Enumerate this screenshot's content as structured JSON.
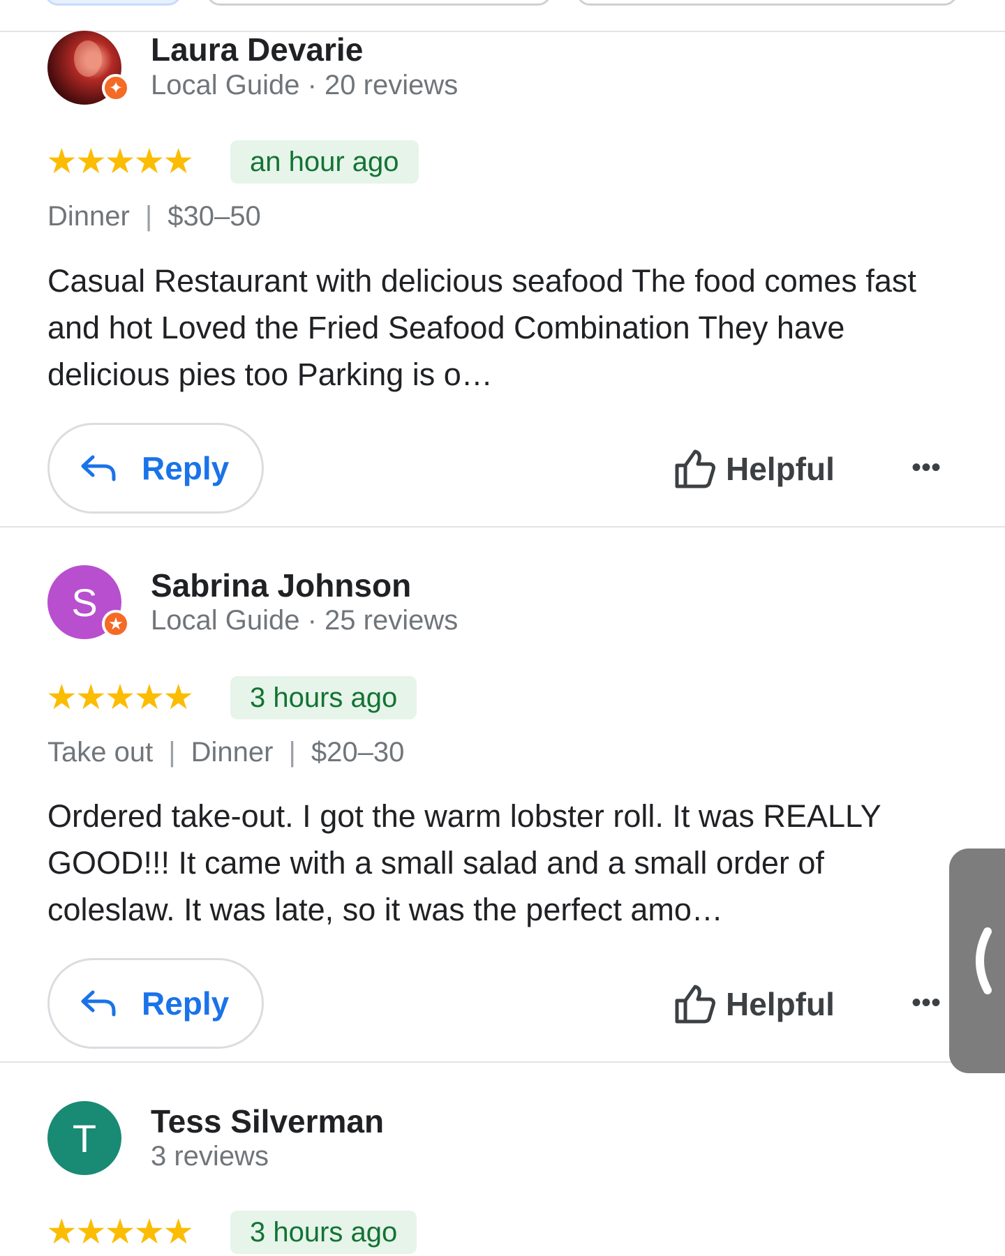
{
  "reviews": [
    {
      "name": "Laura Devarie",
      "meta": "Local Guide · 20 reviews",
      "stars": "★★★★★",
      "rating": 5,
      "time": "an hour ago",
      "tags": [
        "Dinner",
        "$30–50"
      ],
      "text": "Casual Restaurant  with delicious  seafood  The food comes fast and hot Loved the Fried  Seafood Combination  They have delicious  pies too Parking is o…",
      "reply_label": "Reply",
      "helpful_label": "Helpful",
      "more_label": "•••"
    },
    {
      "name": "Sabrina Johnson",
      "avatar_letter": "S",
      "meta": "Local Guide · 25 reviews",
      "stars": "★★★★★",
      "rating": 5,
      "time": "3 hours ago",
      "tags": [
        "Take out",
        "Dinner",
        "$20–30"
      ],
      "text": "Ordered take-out. I got the warm lobster roll. It was REALLY GOOD!!! It came with a small salad and a small order of coleslaw. It was late, so it was the perfect amo…",
      "reply_label": "Reply",
      "helpful_label": "Helpful",
      "more_label": "•••"
    },
    {
      "name": "Tess Silverman",
      "avatar_letter": "T",
      "meta": "3 reviews",
      "stars": "★★★★★",
      "rating": 5,
      "time": "3 hours ago"
    }
  ],
  "tag_separator": "|",
  "colors": {
    "star": "#fbbc04",
    "reply_blue": "#1a73e8",
    "time_badge_bg": "#e6f4ea",
    "time_badge_text": "#137333",
    "local_guide_badge": "#f36b25",
    "avatar_sabrina": "#b84fcf",
    "avatar_tess": "#198a73",
    "side_handle": "#7d7d7d"
  },
  "icons": [
    "reply-arrow-icon",
    "thumbs-up-icon",
    "more-options-icon",
    "local-guide-star-icon",
    "chevron-left-icon"
  ]
}
